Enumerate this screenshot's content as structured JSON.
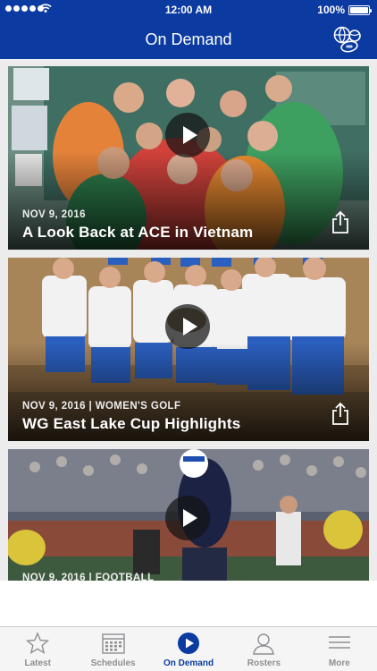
{
  "status_bar": {
    "time": "12:00 AM",
    "battery": "100%"
  },
  "header": {
    "title": "On Demand",
    "right_icon": "sports-balls-icon"
  },
  "videos": [
    {
      "meta": "NOV 9, 2016",
      "title": "A Look Back at ACE in Vietnam"
    },
    {
      "meta": "NOV 9, 2016 | WOMEN'S GOLF",
      "title": "WG East Lake Cup Highlights"
    },
    {
      "meta": "NOV 9, 2016 | FOOTBALL",
      "title": ""
    }
  ],
  "tabs": [
    {
      "label": "Latest",
      "icon": "star-icon"
    },
    {
      "label": "Schedules",
      "icon": "calendar-icon"
    },
    {
      "label": "On Demand",
      "icon": "play-icon"
    },
    {
      "label": "Rosters",
      "icon": "person-icon"
    },
    {
      "label": "More",
      "icon": "menu-icon"
    }
  ],
  "colors": {
    "brand": "#0b3aa0",
    "tab_inactive": "#8e8e93"
  }
}
